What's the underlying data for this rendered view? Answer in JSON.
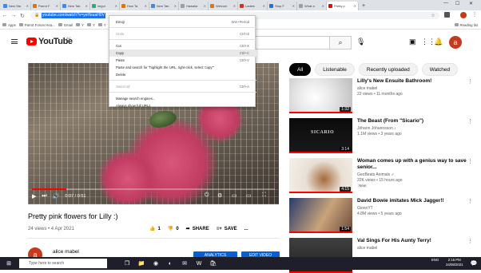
{
  "browser": {
    "tabs": [
      {
        "label": "New Sta",
        "color": "#4285f4"
      },
      {
        "label": "Parrot F",
        "color": "#e37400"
      },
      {
        "label": "New Tab",
        "color": "#4285f4"
      },
      {
        "label": "imgur",
        "color": "#1bb76e"
      },
      {
        "label": "How Ta",
        "color": "#e37400"
      },
      {
        "label": "New Tab",
        "color": "#4285f4"
      },
      {
        "label": "Hawaiia",
        "color": "#9aa0a6"
      },
      {
        "label": "Welcom",
        "color": "#e37400"
      },
      {
        "label": "Ladies",
        "color": "#d93025"
      },
      {
        "label": "Stop F",
        "color": "#1a73e8"
      },
      {
        "label": "What a",
        "color": "#9aa0a6"
      },
      {
        "label": "Pretty p",
        "color": "#ff0000"
      }
    ],
    "new_tab_glyph": "+",
    "window_controls": {
      "minimize": "—",
      "maximize": "☐",
      "close": "✕"
    },
    "url": "youtube.com/watch?v=yeHsuaH0V",
    "bookmarks": [
      "Apps",
      "Parrot Forum Hea...",
      "Gmail",
      "Y",
      "Y",
      "Y",
      "...Arctic Animated I...",
      "Birthday Glitters, Im...",
      "Facebook",
      "10 Top Reasons for...",
      "Reading list"
    ]
  },
  "youtube": {
    "logo": "YouTube",
    "region": "AU",
    "avatar_letter": "a",
    "chips": [
      "All",
      "Listenable",
      "Recently uploaded",
      "Watched"
    ],
    "video": {
      "time_current": "0:07",
      "time_total": "0:51",
      "progress": 0.14,
      "title": "Pretty pink flowers for Lilly :)",
      "meta": "24 views • 4 Apr 2021",
      "likes": "1",
      "dislikes": "0",
      "share_label": "SHARE",
      "save_label": "SAVE",
      "more_label": "...",
      "channel_name": "alice mabel",
      "analytics_label": "ANALYTICS",
      "edit_label": "EDIT VIDEO"
    },
    "sidebar": [
      {
        "title": "Lilly's New Ensuite Bathroom!",
        "channel": "alice mabel",
        "meta": "22 views • 11 months ago",
        "duration": "1:32",
        "badge": ""
      },
      {
        "title": "The Beast (From \"Sicario\")",
        "channel": "Jóhann Jóhannsson ♪",
        "meta": "1.1M views • 3 years ago",
        "duration": "3:14",
        "badge": ""
      },
      {
        "title": "Woman comes up with a genius way to save senior...",
        "channel": "GeoBeats Animals ✓",
        "meta": "22K views • 15 hours ago",
        "duration": "4:15",
        "badge": "New"
      },
      {
        "title": "David Bowie imitates Mick Jagger!!",
        "channel": "GionoYT",
        "meta": "4.8M views • 5 years ago",
        "duration": "1:54",
        "badge": ""
      },
      {
        "title": "Val Sings For His Aunty Terry!",
        "channel": "alice mabel",
        "meta": "",
        "duration": "",
        "badge": ""
      }
    ]
  },
  "context_menu": {
    "items": [
      {
        "label": "Emoji",
        "shortcut": "Win+Period",
        "state": "normal"
      },
      {
        "label": "Undo",
        "shortcut": "Ctrl+Z",
        "state": "dim"
      },
      {
        "label": "Cut",
        "shortcut": "Ctrl+X",
        "state": "normal"
      },
      {
        "label": "Copy",
        "shortcut": "Ctrl+C",
        "state": "highlight"
      },
      {
        "label": "Paste",
        "shortcut": "Ctrl+V",
        "state": "normal"
      },
      {
        "label": "Paste and search for \"highlight the URL, right-click, select 'copy'\"",
        "shortcut": "",
        "state": "normal"
      },
      {
        "label": "Delete",
        "shortcut": "",
        "state": "normal"
      },
      {
        "label": "Select all",
        "shortcut": "Ctrl+A",
        "state": "dim"
      },
      {
        "label": "Manage search engines...",
        "shortcut": "",
        "state": "normal"
      },
      {
        "label": "Always show full URLs",
        "shortcut": "",
        "state": "normal"
      }
    ]
  },
  "taskbar": {
    "search_placeholder": "Type here to search",
    "lang": "ENG",
    "time": "2:15 PM",
    "date": "24/08/2021"
  }
}
